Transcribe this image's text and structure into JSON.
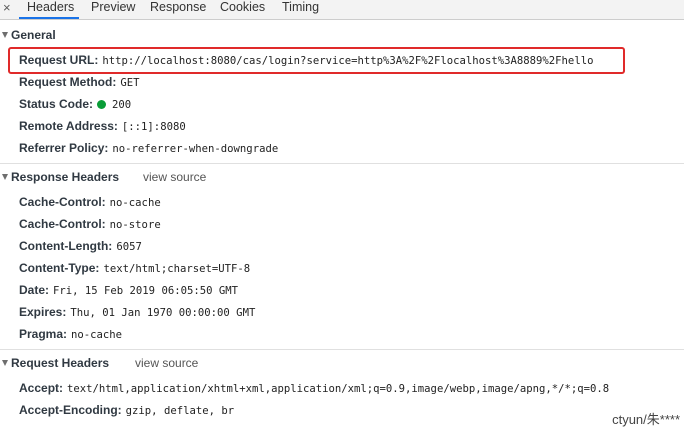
{
  "tabs": {
    "close": "×",
    "items": [
      "Headers",
      "Preview",
      "Response",
      "Cookies",
      "Timing"
    ],
    "active": "Headers"
  },
  "general": {
    "title": "General",
    "rows": [
      {
        "key": "Request URL:",
        "value": "http://localhost:8080/cas/login?service=http%3A%2F%2Flocalhost%3A8889%2Fhello"
      },
      {
        "key": "Request Method:",
        "value": "GET"
      },
      {
        "key": "Status Code:",
        "value": "200",
        "status_color": "#0a9d38"
      },
      {
        "key": "Remote Address:",
        "value": "[::1]:8080"
      },
      {
        "key": "Referrer Policy:",
        "value": "no-referrer-when-downgrade"
      }
    ]
  },
  "response_headers": {
    "title": "Response Headers",
    "view_source": "view source",
    "rows": [
      {
        "key": "Cache-Control:",
        "value": "no-cache"
      },
      {
        "key": "Cache-Control:",
        "value": "no-store"
      },
      {
        "key": "Content-Length:",
        "value": "6057"
      },
      {
        "key": "Content-Type:",
        "value": "text/html;charset=UTF-8"
      },
      {
        "key": "Date:",
        "value": "Fri, 15 Feb 2019 06:05:50 GMT"
      },
      {
        "key": "Expires:",
        "value": "Thu, 01 Jan 1970 00:00:00 GMT"
      },
      {
        "key": "Pragma:",
        "value": "no-cache"
      }
    ]
  },
  "request_headers": {
    "title": "Request Headers",
    "view_source": "view source",
    "rows": [
      {
        "key": "Accept:",
        "value": "text/html,application/xhtml+xml,application/xml;q=0.9,image/webp,image/apng,*/*;q=0.8"
      },
      {
        "key": "Accept-Encoding:",
        "value": "gzip, deflate, br"
      }
    ]
  },
  "watermark": "ctyun/朱****",
  "colors": {
    "highlight_border": "#e02a2a",
    "active_tab": "#1a73e8",
    "status_ok": "#0a9d38"
  }
}
